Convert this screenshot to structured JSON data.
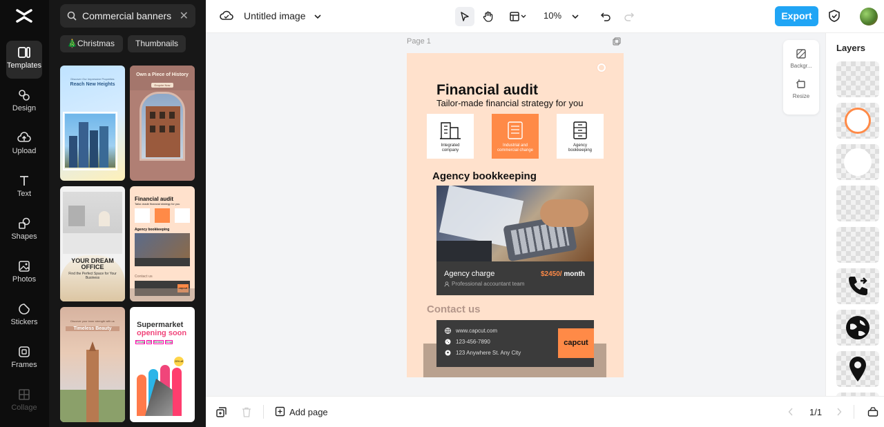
{
  "rail": {
    "items": [
      {
        "label": "Templates",
        "icon": "templates-icon"
      },
      {
        "label": "Design",
        "icon": "design-icon"
      },
      {
        "label": "Upload",
        "icon": "upload-icon"
      },
      {
        "label": "Text",
        "icon": "text-icon"
      },
      {
        "label": "Shapes",
        "icon": "shapes-icon"
      },
      {
        "label": "Photos",
        "icon": "photos-icon"
      },
      {
        "label": "Stickers",
        "icon": "stickers-icon"
      },
      {
        "label": "Frames",
        "icon": "frames-icon"
      },
      {
        "label": "Collage",
        "icon": "collage-icon"
      }
    ]
  },
  "panel": {
    "search_value": "Commercial banners",
    "chips": [
      "🎄Christmas",
      "Thumbnails"
    ],
    "thumbs": {
      "t1": {
        "top": "Discover Our Impressive Properties",
        "title": "Reach New Heights"
      },
      "t2": {
        "title": "Own a Piece of History",
        "btn": "Enquire Now"
      },
      "t3": {
        "title": "YOUR DREAM OFFICE",
        "sub": "Find the Perfect Space for Your Business"
      },
      "t4": {
        "title": "Financial audit",
        "sub": "Tailor-made financial strategy for you",
        "h2": "Agency bookkeeping",
        "contact": "Contact us",
        "brand": "capcut"
      },
      "t5": {
        "top": "Discover your inner strength with us",
        "title": "Timeless Beauty"
      },
      "t6": {
        "title1": "Supermarket",
        "title2": "opening soon",
        "tags": [
          "Friendly",
          "Gift",
          "Member",
          "Group"
        ],
        "badge": "20% off"
      }
    }
  },
  "topbar": {
    "doc_title": "Untitled image",
    "zoom": "10%",
    "export": "Export"
  },
  "canvas": {
    "page_label": "Page 1",
    "float_panel": {
      "background": "Backgr...",
      "resize": "Resize"
    },
    "poster": {
      "title": "Financial audit",
      "subtitle": "Tailor-made financial strategy for you",
      "cards": [
        {
          "label": "Integrated company",
          "highlight": false
        },
        {
          "label": "Industrial and commercial change",
          "highlight": true
        },
        {
          "label": "Agency bookkeeping",
          "highlight": false
        }
      ],
      "section": "Agency bookkeeping",
      "charge_label": "Agency charge",
      "price": "$2450/",
      "price_unit": " month",
      "accountant": "Professional accountant team",
      "contact_heading": "Contact us",
      "contacts": [
        "www.capcut.com",
        "123-456-7890",
        "123 Anywhere St. Any City"
      ],
      "brand": "capcut"
    }
  },
  "bottombar": {
    "add_page": "Add page",
    "pager": "1/1"
  },
  "layers": {
    "title": "Layers"
  },
  "colors": {
    "accent": "#20a5f5",
    "orange": "#ff8a47",
    "poster_bg": "#ffe1cc",
    "dark": "#3b3b3b"
  }
}
